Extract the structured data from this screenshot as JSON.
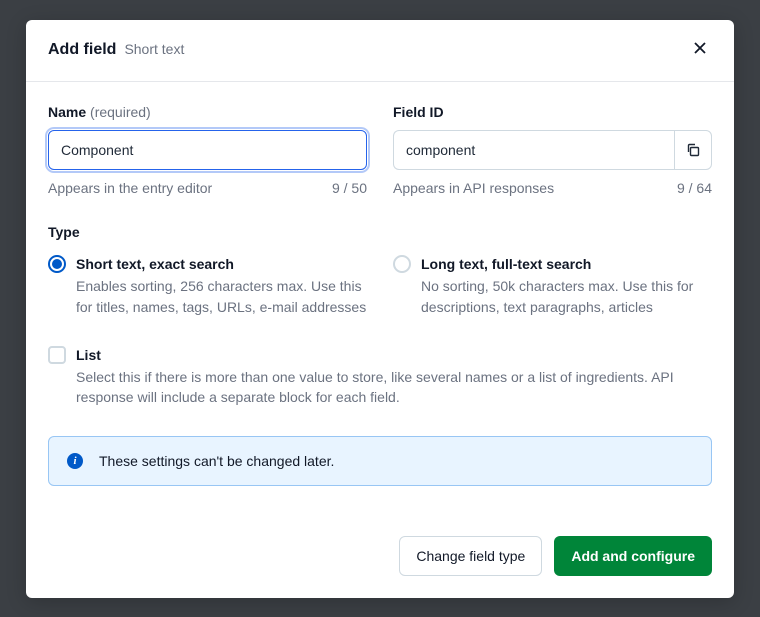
{
  "header": {
    "title": "Add field",
    "subtitle": "Short text"
  },
  "name_field": {
    "label": "Name",
    "required_hint": "(required)",
    "value": "Component",
    "helper": "Appears in the entry editor",
    "counter": "9 / 50"
  },
  "id_field": {
    "label": "Field ID",
    "value": "component",
    "helper": "Appears in API responses",
    "counter": "9 / 64"
  },
  "type_section": {
    "label": "Type",
    "short": {
      "title": "Short text, exact search",
      "desc": "Enables sorting, 256 characters max. Use this for titles, names, tags, URLs, e-mail addresses"
    },
    "long": {
      "title": "Long text, full-text search",
      "desc": "No sorting, 50k characters max. Use this for descriptions, text paragraphs, articles"
    }
  },
  "list_option": {
    "title": "List",
    "desc": "Select this if there is more than one value to store, like several names or a list of ingredients. API response will include a separate block for each field."
  },
  "info_banner": {
    "text": "These settings can't be changed later."
  },
  "footer": {
    "change_type": "Change field type",
    "add_configure": "Add and configure"
  }
}
